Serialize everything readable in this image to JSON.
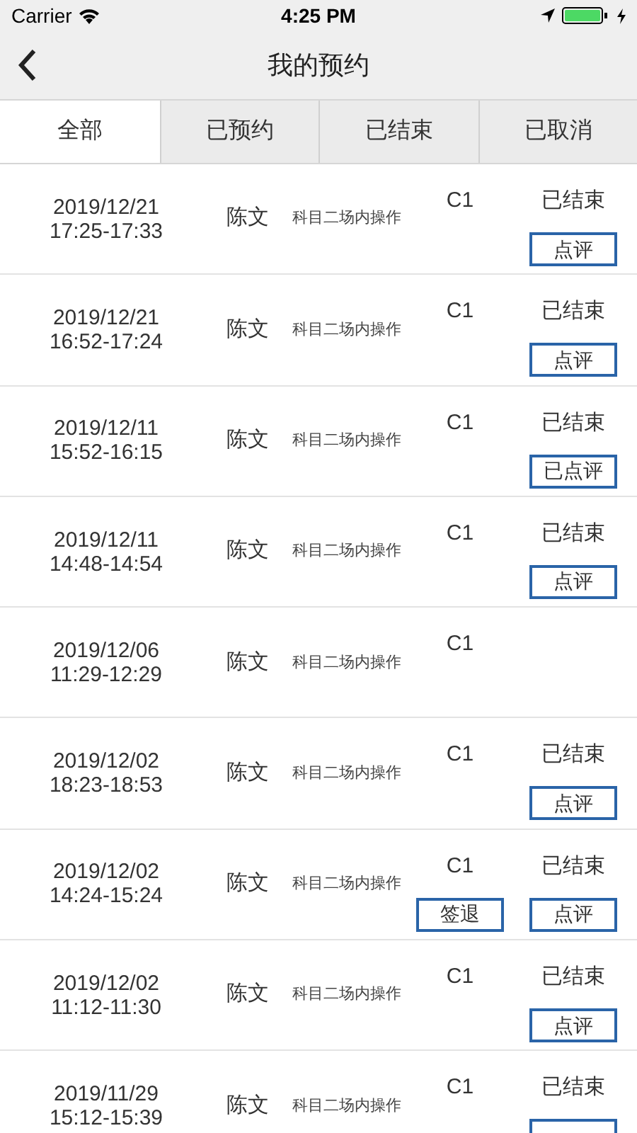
{
  "status_bar": {
    "carrier": "Carrier",
    "time": "4:25 PM"
  },
  "header": {
    "title": "我的预约"
  },
  "tabs": [
    {
      "label": "全部",
      "selected": true
    },
    {
      "label": "已预约",
      "selected": false
    },
    {
      "label": "已结束",
      "selected": false
    },
    {
      "label": "已取消",
      "selected": false
    }
  ],
  "rows": [
    {
      "date": "2019/12/21",
      "time": "17:25-17:33",
      "name": "陈文",
      "subject": "科目二场内操作",
      "license": "C1",
      "status": "已结束",
      "review_button": "点评"
    },
    {
      "date": "2019/12/21",
      "time": "16:52-17:24",
      "name": "陈文",
      "subject": "科目二场内操作",
      "license": "C1",
      "status": "已结束",
      "review_button": "点评"
    },
    {
      "date": "2019/12/11",
      "time": "15:52-16:15",
      "name": "陈文",
      "subject": "科目二场内操作",
      "license": "C1",
      "status": "已结束",
      "review_button": "已点评"
    },
    {
      "date": "2019/12/11",
      "time": "14:48-14:54",
      "name": "陈文",
      "subject": "科目二场内操作",
      "license": "C1",
      "status": "已结束",
      "review_button": "点评"
    },
    {
      "date": "2019/12/06",
      "time": "11:29-12:29",
      "name": "陈文",
      "subject": "科目二场内操作",
      "license": "C1"
    },
    {
      "date": "2019/12/02",
      "time": "18:23-18:53",
      "name": "陈文",
      "subject": "科目二场内操作",
      "license": "C1",
      "status": "已结束",
      "review_button": "点评"
    },
    {
      "date": "2019/12/02",
      "time": "14:24-15:24",
      "name": "陈文",
      "subject": "科目二场内操作",
      "license": "C1",
      "status": "已结束",
      "checkout_button": "签退",
      "review_button": "点评"
    },
    {
      "date": "2019/12/02",
      "time": "11:12-11:30",
      "name": "陈文",
      "subject": "科目二场内操作",
      "license": "C1",
      "status": "已结束",
      "review_button": "点评"
    },
    {
      "date": "2019/11/29",
      "time": "15:12-15:39",
      "name": "陈文",
      "subject": "科目二场内操作",
      "license": "C1",
      "status": "已结束",
      "review_button_edge": true
    }
  ]
}
